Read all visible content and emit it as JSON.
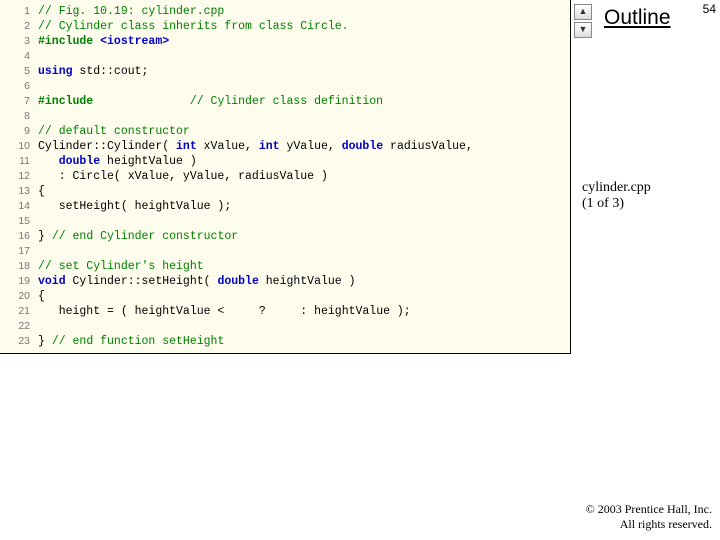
{
  "page_number": "54",
  "outline_label": "Outline",
  "subtitle": {
    "file": "cylinder.cpp",
    "part": "(1 of 3)"
  },
  "copyright": {
    "l1": "© 2003 Prentice Hall, Inc.",
    "l2": "All rights reserved."
  },
  "expand": {
    "up": "▲",
    "down": "▼"
  },
  "code": {
    "lines": [
      {
        "n": "1",
        "segs": [
          {
            "t": "// Fig. 10.19: cylinder.cpp",
            "c": "c-comment"
          }
        ]
      },
      {
        "n": "2",
        "segs": [
          {
            "t": "// Cylinder class inherits from class Circle.",
            "c": "c-comment"
          }
        ]
      },
      {
        "n": "3",
        "segs": [
          {
            "t": "#include ",
            "c": "c-pre"
          },
          {
            "t": "<iostream>",
            "c": "c-kw"
          }
        ]
      },
      {
        "n": "4",
        "segs": [
          {
            "t": "",
            "c": "c-plain"
          }
        ]
      },
      {
        "n": "5",
        "segs": [
          {
            "t": "using ",
            "c": "c-kw"
          },
          {
            "t": "std::cout;",
            "c": "c-plain"
          }
        ]
      },
      {
        "n": "6",
        "segs": [
          {
            "t": "",
            "c": "c-plain"
          }
        ]
      },
      {
        "n": "7",
        "segs": [
          {
            "t": "#include",
            "c": "c-pre"
          },
          {
            "t": "              ",
            "c": "c-plain"
          },
          {
            "t": "// Cylinder class definition",
            "c": "c-comment"
          }
        ]
      },
      {
        "n": "8",
        "segs": [
          {
            "t": "",
            "c": "c-plain"
          }
        ]
      },
      {
        "n": "9",
        "segs": [
          {
            "t": "// default constructor",
            "c": "c-comment"
          }
        ]
      },
      {
        "n": "10",
        "segs": [
          {
            "t": "Cylinder::Cylinder( ",
            "c": "c-plain"
          },
          {
            "t": "int",
            "c": "c-kw"
          },
          {
            "t": " xValue, ",
            "c": "c-plain"
          },
          {
            "t": "int",
            "c": "c-kw"
          },
          {
            "t": " yValue, ",
            "c": "c-plain"
          },
          {
            "t": "double",
            "c": "c-kw"
          },
          {
            "t": " radiusValue,",
            "c": "c-plain"
          }
        ]
      },
      {
        "n": "11",
        "segs": [
          {
            "t": "   ",
            "c": "c-plain"
          },
          {
            "t": "double",
            "c": "c-kw"
          },
          {
            "t": " heightValue )",
            "c": "c-plain"
          }
        ]
      },
      {
        "n": "12",
        "segs": [
          {
            "t": "   : Circle( xValue, yValue, radiusValue )",
            "c": "c-plain"
          }
        ]
      },
      {
        "n": "13",
        "segs": [
          {
            "t": "{",
            "c": "c-plain"
          }
        ]
      },
      {
        "n": "14",
        "segs": [
          {
            "t": "   setHeight( heightValue );",
            "c": "c-plain"
          }
        ]
      },
      {
        "n": "15",
        "segs": [
          {
            "t": "",
            "c": "c-plain"
          }
        ]
      },
      {
        "n": "16",
        "segs": [
          {
            "t": "} ",
            "c": "c-plain"
          },
          {
            "t": "// end Cylinder constructor",
            "c": "c-comment"
          }
        ]
      },
      {
        "n": "17",
        "segs": [
          {
            "t": "",
            "c": "c-plain"
          }
        ]
      },
      {
        "n": "18",
        "segs": [
          {
            "t": "// set Cylinder's height",
            "c": "c-comment"
          }
        ]
      },
      {
        "n": "19",
        "segs": [
          {
            "t": "void",
            "c": "c-kw"
          },
          {
            "t": " Cylinder::setHeight( ",
            "c": "c-plain"
          },
          {
            "t": "double",
            "c": "c-kw"
          },
          {
            "t": " heightValue )",
            "c": "c-plain"
          }
        ]
      },
      {
        "n": "20",
        "segs": [
          {
            "t": "{",
            "c": "c-plain"
          }
        ]
      },
      {
        "n": "21",
        "segs": [
          {
            "t": "   height = ( heightValue < ",
            "c": "c-plain"
          },
          {
            "t": "   ",
            "c": "c-kw"
          },
          {
            "t": " ? ",
            "c": "c-plain"
          },
          {
            "t": "   ",
            "c": "c-kw"
          },
          {
            "t": " : heightValue );",
            "c": "c-plain"
          }
        ]
      },
      {
        "n": "22",
        "segs": [
          {
            "t": "",
            "c": "c-plain"
          }
        ]
      },
      {
        "n": "23",
        "segs": [
          {
            "t": "} ",
            "c": "c-plain"
          },
          {
            "t": "// end function setHeight",
            "c": "c-comment"
          }
        ]
      }
    ]
  }
}
